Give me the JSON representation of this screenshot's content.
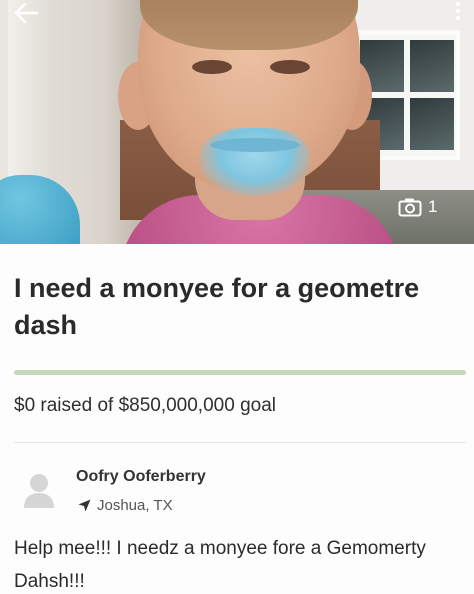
{
  "campaign": {
    "title": "I need a monyee for a geometre dash",
    "raised_text": "$0 raised of $850,000,000 goal",
    "raised_amount": 0,
    "goal_amount": 850000000,
    "progress_fraction": 0
  },
  "hero": {
    "photo_count": "1",
    "back_icon": "arrow-left-icon",
    "menu_icon": "more-vertical-icon",
    "camera_icon": "camera-icon"
  },
  "organizer": {
    "name": "Oofry Ooferberry",
    "location": "Joshua, TX",
    "avatar_icon": "default-avatar-icon",
    "location_icon": "location-arrow-icon"
  },
  "story": {
    "text": "Help mee!!! I needz a monyee fore a Gemomerty Dahsh!!!"
  },
  "colors": {
    "progress_fill": "#5aa332",
    "progress_track": "#c5d9b8",
    "text": "#2b2b2b"
  }
}
